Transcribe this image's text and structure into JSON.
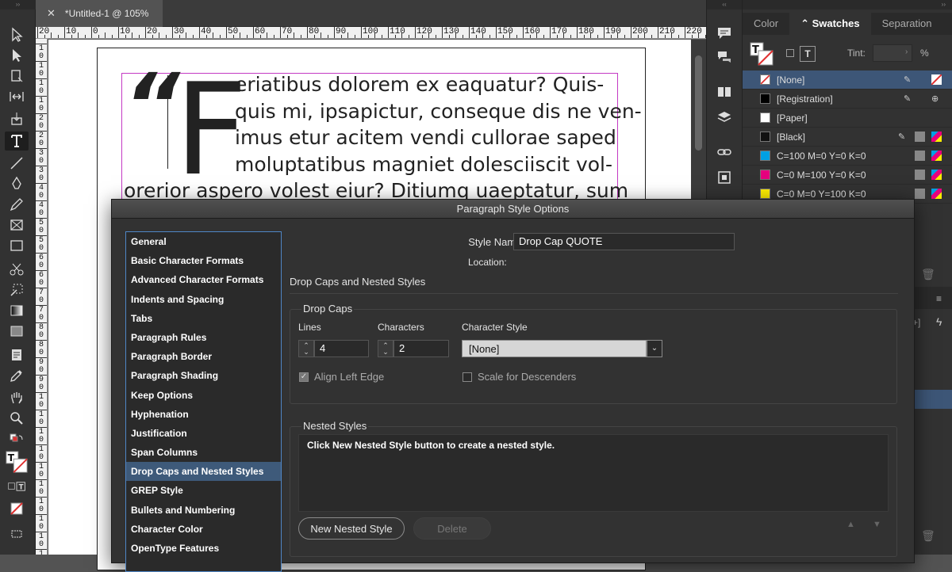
{
  "document": {
    "tab_label": "*Untitled-1 @ 105%",
    "ruler_marks": [
      "20",
      "10",
      "0",
      "10",
      "20",
      "30",
      "40",
      "50",
      "60",
      "70",
      "80",
      "90",
      "100",
      "110",
      "120",
      "130",
      "140",
      "150",
      "160",
      "170",
      "180",
      "190",
      "200",
      "210",
      "220"
    ],
    "vruler_marks": [
      "1",
      "1",
      "1",
      "1",
      "2",
      "2",
      "3",
      "3",
      "4",
      "4",
      "5",
      "5",
      "6",
      "6",
      "7",
      "7",
      "8",
      "8",
      "9",
      "9",
      "1",
      "1",
      "1",
      "1",
      "1",
      "1",
      "1",
      "1",
      "1",
      "1"
    ],
    "quote_mark": "“",
    "drop_cap": "F",
    "text_lines": [
      "eriatibus dolorem ex eaquatur? Quis-",
      "quis mi, ipsapictur, conseque dis ne ven-",
      "imus etur acitem vendi cullorae saped",
      "moluptatibus magniet dolesciiscit vol-",
      "orerior aspero volest eiur? Ditiumq uaeptatur, sum"
    ]
  },
  "swatches_panel": {
    "tabs": [
      "Color",
      "Swatches",
      "Separation"
    ],
    "active_tab": "Swatches",
    "tint_label": "Tint:",
    "tint_value": "",
    "percent": "%",
    "swatches": [
      {
        "name": "[None]",
        "color": "none",
        "selected": true
      },
      {
        "name": "[Registration]",
        "color": "#000000",
        "selected": false
      },
      {
        "name": "[Paper]",
        "color": "#ffffff",
        "selected": false
      },
      {
        "name": "[Black]",
        "color": "#111111",
        "selected": false
      },
      {
        "name": "C=100 M=0 Y=0 K=0",
        "color": "#00a0e4",
        "selected": false
      },
      {
        "name": "C=0 M=100 Y=0 K=0",
        "color": "#e6007e",
        "selected": false
      },
      {
        "name": "C=0 M=0 Y=100 K=0",
        "color": "#ffed00",
        "selected": false
      }
    ]
  },
  "dialog": {
    "title": "Paragraph Style Options",
    "style_name_label": "Style Name:",
    "style_name_value": "Drop Cap QUOTE",
    "location_label": "Location:",
    "section_heading": "Drop Caps and Nested Styles",
    "categories": [
      "General",
      "Basic Character Formats",
      "Advanced Character Formats",
      "Indents and Spacing",
      "Tabs",
      "Paragraph Rules",
      "Paragraph Border",
      "Paragraph Shading",
      "Keep Options",
      "Hyphenation",
      "Justification",
      "Span Columns",
      "Drop Caps and Nested Styles",
      "GREP Style",
      "Bullets and Numbering",
      "Character Color",
      "OpenType Features"
    ],
    "active_category": "Drop Caps and Nested Styles",
    "drop_caps": {
      "group_label": "Drop Caps",
      "lines_label": "Lines",
      "lines_value": "4",
      "characters_label": "Characters",
      "characters_value": "2",
      "char_style_label": "Character Style",
      "char_style_value": "[None]",
      "align_left_edge_label": "Align Left Edge",
      "align_left_edge_checked": true,
      "scale_descenders_label": "Scale for Descenders",
      "scale_descenders_checked": false
    },
    "nested": {
      "group_label": "Nested Styles",
      "empty_message": "Click New Nested Style button to create a nested style.",
      "new_button": "New Nested Style",
      "delete_button": "Delete"
    }
  }
}
